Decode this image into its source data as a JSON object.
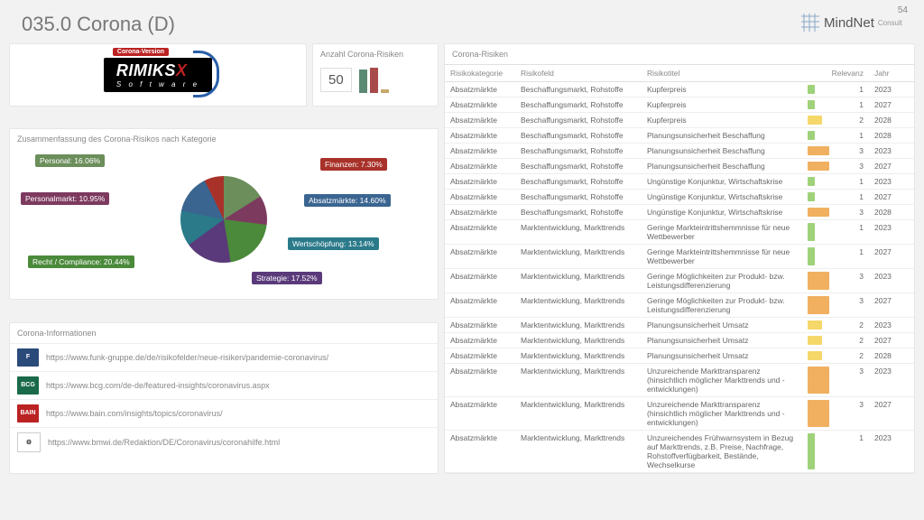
{
  "page_number": "54",
  "title": "035.0 Corona (D)",
  "brand": {
    "name": "MindNet",
    "sub": "Consult"
  },
  "logo": {
    "tag": "Corona-Version",
    "name": "RIMIKS",
    "x": "X",
    "software": "S o f t w a r e"
  },
  "kpi": {
    "title": "Anzahl Corona-Risiken",
    "value": "50"
  },
  "pie": {
    "title": "Zusammenfassung des Corona-Risikos nach Kategorie"
  },
  "chart_data": {
    "type": "pie",
    "title": "Zusammenfassung des Corona-Risikos nach Kategorie",
    "series": [
      {
        "name": "Personal",
        "value": 16.06,
        "label": "Personal: 16.06%",
        "color": "#6b8e5a"
      },
      {
        "name": "Personalmarkt",
        "value": 10.95,
        "label": "Personalmarkt: 10.95%",
        "color": "#7d3a5f"
      },
      {
        "name": "Recht / Compliance",
        "value": 20.44,
        "label": "Recht / Compliance: 20.44%",
        "color": "#4a8a3a"
      },
      {
        "name": "Strategie",
        "value": 17.52,
        "label": "Strategie: 17.52%",
        "color": "#5a3a7a"
      },
      {
        "name": "Wertschöpfung",
        "value": 13.14,
        "label": "Wertschöpfung: 13.14%",
        "color": "#2a7a8a"
      },
      {
        "name": "Absatzmärkte",
        "value": 14.6,
        "label": "Absatzmärkte: 14.60%",
        "color": "#3a6590"
      },
      {
        "name": "Finanzen",
        "value": 7.3,
        "label": "Finanzen: 7.30%",
        "color": "#a8322a"
      }
    ]
  },
  "spark": [
    {
      "h": 26,
      "c": "#5b8a72"
    },
    {
      "h": 28,
      "c": "#a84b4b"
    },
    {
      "h": 4,
      "c": "#c7a86a"
    }
  ],
  "links": {
    "title": "Corona-Informationen",
    "items": [
      {
        "logo": "F",
        "bg": "#2a4a7a",
        "url": "https://www.funk-gruppe.de/de/risikofelder/neue-risiken/pandemie-coronavirus/"
      },
      {
        "logo": "BCG",
        "bg": "#1a6a4a",
        "url": "https://www.bcg.com/de-de/featured-insights/coronavirus.aspx"
      },
      {
        "logo": "BAIN",
        "bg": "#b22",
        "url": "https://www.bain.com/insights/topics/coronavirus/"
      },
      {
        "logo": "⚙",
        "bg": "#fff",
        "url": "https://www.bmwi.de/Redaktion/DE/Coronavirus/coronahilfe.html"
      }
    ]
  },
  "table": {
    "title": "Corona-Risiken",
    "cols": [
      "Risikokategorie",
      "Risikofeld",
      "Risikotitel",
      "Relevanz",
      "Jahr"
    ],
    "rows": [
      {
        "k": "Absatzmärkte",
        "f": "Beschaffungsmarkt, Rohstoffe",
        "t": "Kupferpreis",
        "r": 1,
        "c": "#9fd27a",
        "j": "2023"
      },
      {
        "k": "Absatzmärkte",
        "f": "Beschaffungsmarkt, Rohstoffe",
        "t": "Kupferpreis",
        "r": 1,
        "c": "#9fd27a",
        "j": "2027"
      },
      {
        "k": "Absatzmärkte",
        "f": "Beschaffungsmarkt, Rohstoffe",
        "t": "Kupferpreis",
        "r": 2,
        "c": "#f5d76a",
        "j": "2028"
      },
      {
        "k": "Absatzmärkte",
        "f": "Beschaffungsmarkt, Rohstoffe",
        "t": "Planungsunsicherheit Beschaffung",
        "r": 1,
        "c": "#9fd27a",
        "j": "2028"
      },
      {
        "k": "Absatzmärkte",
        "f": "Beschaffungsmarkt, Rohstoffe",
        "t": "Planungsunsicherheit Beschaffung",
        "r": 3,
        "c": "#f0b060",
        "j": "2023"
      },
      {
        "k": "Absatzmärkte",
        "f": "Beschaffungsmarkt, Rohstoffe",
        "t": "Planungsunsicherheit Beschaffung",
        "r": 3,
        "c": "#f0b060",
        "j": "2027"
      },
      {
        "k": "Absatzmärkte",
        "f": "Beschaffungsmarkt, Rohstoffe",
        "t": "Ungünstige Konjunktur, Wirtschaftskrise",
        "r": 1,
        "c": "#9fd27a",
        "j": "2023"
      },
      {
        "k": "Absatzmärkte",
        "f": "Beschaffungsmarkt, Rohstoffe",
        "t": "Ungünstige Konjunktur, Wirtschaftskrise",
        "r": 1,
        "c": "#9fd27a",
        "j": "2027"
      },
      {
        "k": "Absatzmärkte",
        "f": "Beschaffungsmarkt, Rohstoffe",
        "t": "Ungünstige Konjunktur, Wirtschaftskrise",
        "r": 3,
        "c": "#f0b060",
        "j": "2028"
      },
      {
        "k": "Absatzmärkte",
        "f": "Marktentwicklung, Markttrends",
        "t": "Geringe Markteintrittshemmnisse für neue Wettbewerber",
        "r": 1,
        "c": "#9fd27a",
        "j": "2023"
      },
      {
        "k": "Absatzmärkte",
        "f": "Marktentwicklung, Markttrends",
        "t": "Geringe Markteintrittshemmnisse für neue Wettbewerber",
        "r": 1,
        "c": "#9fd27a",
        "j": "2027"
      },
      {
        "k": "Absatzmärkte",
        "f": "Marktentwicklung, Markttrends",
        "t": "Geringe Möglichkeiten zur Produkt- bzw. Leistungsdifferenzierung",
        "r": 3,
        "c": "#f0b060",
        "j": "2023"
      },
      {
        "k": "Absatzmärkte",
        "f": "Marktentwicklung, Markttrends",
        "t": "Geringe Möglichkeiten zur Produkt- bzw. Leistungsdifferenzierung",
        "r": 3,
        "c": "#f0b060",
        "j": "2027"
      },
      {
        "k": "Absatzmärkte",
        "f": "Marktentwicklung, Markttrends",
        "t": "Planungsunsicherheit Umsatz",
        "r": 2,
        "c": "#f5d76a",
        "j": "2023"
      },
      {
        "k": "Absatzmärkte",
        "f": "Marktentwicklung, Markttrends",
        "t": "Planungsunsicherheit Umsatz",
        "r": 2,
        "c": "#f5d76a",
        "j": "2027"
      },
      {
        "k": "Absatzmärkte",
        "f": "Marktentwicklung, Markttrends",
        "t": "Planungsunsicherheit Umsatz",
        "r": 2,
        "c": "#f5d76a",
        "j": "2028"
      },
      {
        "k": "Absatzmärkte",
        "f": "Marktentwicklung, Markttrends",
        "t": "Unzureichende Markttransparenz (hinsichtlich möglicher Markttrends und -entwicklungen)",
        "r": 3,
        "c": "#f0b060",
        "j": "2023"
      },
      {
        "k": "Absatzmärkte",
        "f": "Marktentwicklung, Markttrends",
        "t": "Unzureichende Markttransparenz (hinsichtlich möglicher Markttrends und -entwicklungen)",
        "r": 3,
        "c": "#f0b060",
        "j": "2027"
      },
      {
        "k": "Absatzmärkte",
        "f": "Marktentwicklung, Markttrends",
        "t": "Unzureichendes Frühwarnsystem in Bezug auf Markttrends, z.B. Preise, Nachfrage, Rohstoffverfügbarkeit, Bestände, Wechselkurse",
        "r": 1,
        "c": "#9fd27a",
        "j": "2023"
      }
    ]
  }
}
